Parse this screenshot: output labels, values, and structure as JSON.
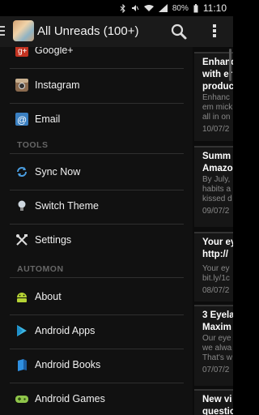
{
  "status_bar": {
    "battery": "80%",
    "time": "11:10"
  },
  "action_bar": {
    "title": "All Unreads (100+)"
  },
  "drawer": {
    "items_top": [
      {
        "label": "Google+",
        "icon": "google-plus-icon"
      },
      {
        "label": "Instagram",
        "icon": "instagram-icon"
      },
      {
        "label": "Email",
        "icon": "email-icon"
      }
    ],
    "tools_header": "TOOLS",
    "tools": [
      {
        "label": "Sync Now",
        "icon": "sync-icon"
      },
      {
        "label": "Switch Theme",
        "icon": "lightbulb-icon"
      },
      {
        "label": "Settings",
        "icon": "settings-icon"
      }
    ],
    "automon_header": "AUTOMON",
    "automon": [
      {
        "label": "About",
        "icon": "android-icon"
      },
      {
        "label": "Android Apps",
        "icon": "play-store-icon"
      },
      {
        "label": "Android Books",
        "icon": "books-icon"
      },
      {
        "label": "Android Games",
        "icon": "gamepad-icon"
      }
    ]
  },
  "articles": [
    {
      "line1": "Enhanc",
      "line2": "with er",
      "line3": "produc",
      "snip1": "Enhanc",
      "snip2": "em mick",
      "snip3": "all in on",
      "date": "10/07/2"
    },
    {
      "line1": "Summ",
      "line2": "Amazo",
      "snip1": "By July,",
      "snip2": "habits a",
      "snip3": "kissed d",
      "date": "09/07/2"
    },
    {
      "line1": "Your ey",
      "line2": "http://",
      "snip1": "Your ey",
      "snip2": "bit.ly/1c",
      "date": "08/07/2"
    },
    {
      "line1": "3 Eyela",
      "line2": "Maxim",
      "snip1": "Our eye",
      "snip2": "we alwa",
      "snip3": "That's w",
      "date": "07/07/2"
    },
    {
      "line1": "New vi",
      "line2": "questio"
    }
  ],
  "colors": {
    "accent": "#33b5e5",
    "drawer_bg": "#111111"
  }
}
